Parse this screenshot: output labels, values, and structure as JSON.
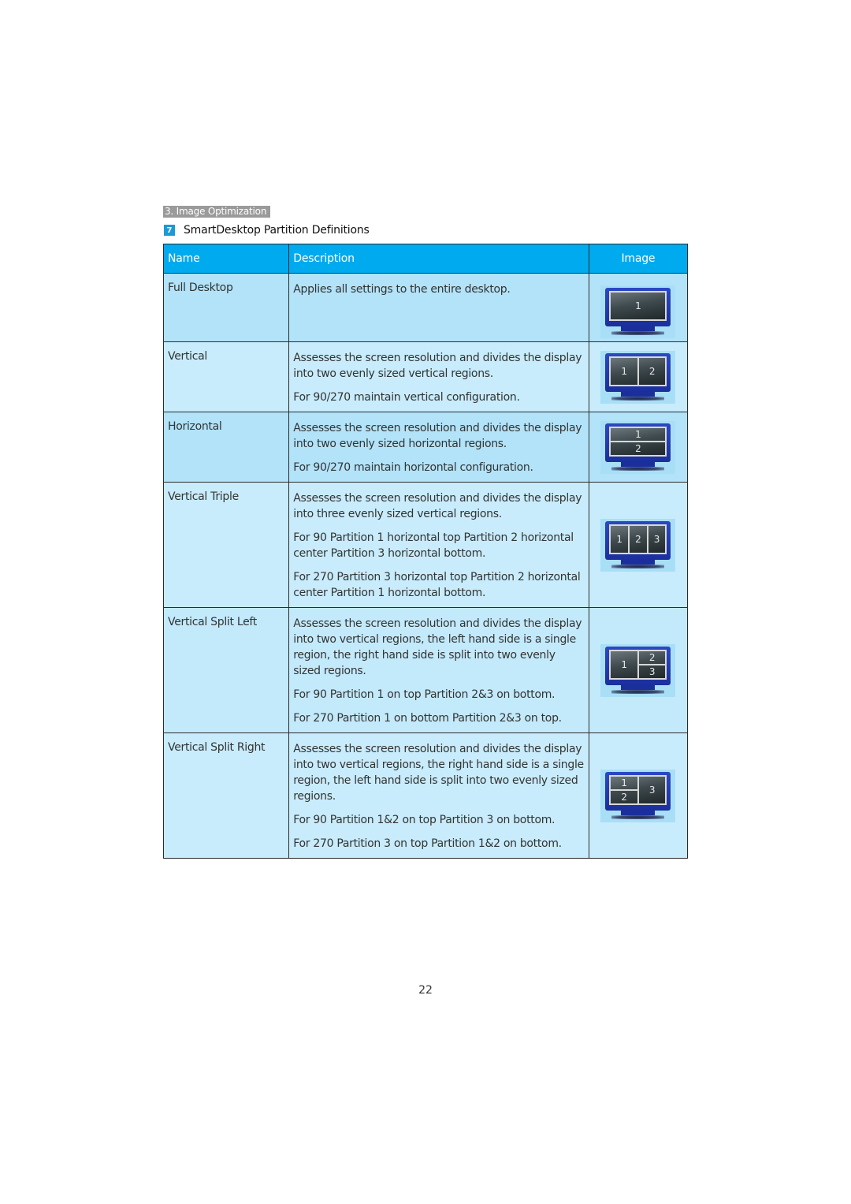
{
  "section_tag": "3. Image Optimization",
  "heading": {
    "badge": "7",
    "title": "SmartDesktop Partition Definitions"
  },
  "table": {
    "headers": {
      "name": "Name",
      "description": "Description",
      "image": "Image"
    },
    "rows": [
      {
        "name": "Full Desktop",
        "description": [
          "Applies all settings to the entire desktop."
        ],
        "image": {
          "icon": "monitor-full-desktop-icon",
          "layout": "full",
          "labels": [
            "1"
          ]
        }
      },
      {
        "name": "Vertical",
        "description": [
          "Assesses the screen resolution and divides the display into two evenly sized vertical regions.",
          "For 90/270 maintain vertical configuration."
        ],
        "image": {
          "icon": "monitor-vertical-icon",
          "layout": "vertical",
          "labels": [
            "1",
            "2"
          ]
        }
      },
      {
        "name": "Horizontal",
        "description": [
          "Assesses the screen resolution and divides the display into two evenly sized horizontal regions.",
          "For 90/270 maintain horizontal configuration."
        ],
        "image": {
          "icon": "monitor-horizontal-icon",
          "layout": "horizontal",
          "labels": [
            "1",
            "2"
          ]
        }
      },
      {
        "name": "Vertical Triple",
        "description": [
          "Assesses the screen resolution and divides the display into three evenly sized vertical regions.",
          "For 90 Partition 1 horizontal top Partition 2 horizontal center Partition 3 horizontal bottom.",
          "For 270 Partition 3 horizontal top Partition 2 horizontal center Partition 1 horizontal bottom."
        ],
        "image": {
          "icon": "monitor-vertical-triple-icon",
          "layout": "vertical-triple",
          "labels": [
            "1",
            "2",
            "3"
          ]
        }
      },
      {
        "name": "Vertical Split Left",
        "description": [
          "Assesses the screen resolution and divides the display into two vertical regions, the left hand side is a single region, the right hand side is split into two evenly sized regions.",
          "For 90 Partition 1 on top Partition 2&3 on bottom.",
          "For 270 Partition 1 on bottom Partition 2&3 on top."
        ],
        "image": {
          "icon": "monitor-split-left-icon",
          "layout": "split-left",
          "labels": [
            "1",
            "2",
            "3"
          ]
        }
      },
      {
        "name": "Vertical Split Right",
        "description": [
          "Assesses the screen resolution and divides the display into two vertical regions, the right  hand side is a single region, the left  hand side is split into two evenly sized regions.",
          "For 90 Partition 1&2  on top Partition 3 on bottom.",
          "For 270 Partition 3 on top Partition 1&2 on bottom."
        ],
        "image": {
          "icon": "monitor-split-right-icon",
          "layout": "split-right",
          "labels": [
            "1",
            "2",
            "3"
          ]
        }
      }
    ]
  },
  "colors": {
    "header_bg": "#00aaef",
    "row_dark": "#b2e3f8",
    "row_light": "#c8ecfb",
    "section_tag_bg": "#9a9a9a",
    "badge_bg": "#1a9ad6"
  },
  "page_number": "22"
}
